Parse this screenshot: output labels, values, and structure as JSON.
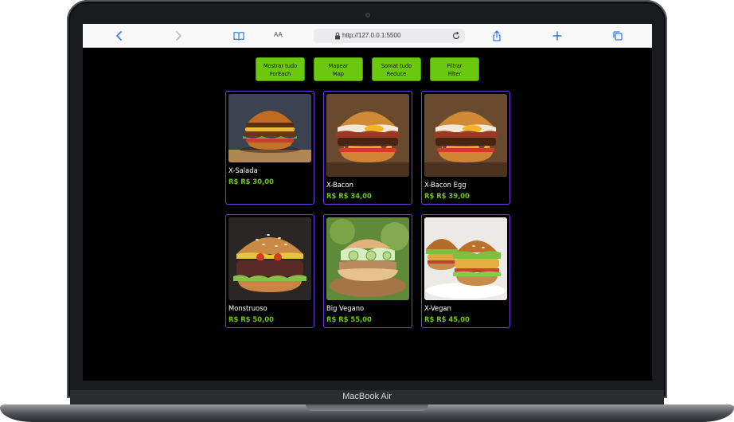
{
  "device": {
    "label": "MacBook Air"
  },
  "browser": {
    "reader_label": "AA",
    "url": "http://127.0.0.1:5500"
  },
  "buttons": [
    {
      "line1": "Mostrar tudo",
      "line2": "ForEach"
    },
    {
      "line1": "Mapear",
      "line2": "Map"
    },
    {
      "line1": "Somat tudo",
      "line2": "Reduce"
    },
    {
      "line1": "Filtrar",
      "line2": "Filter"
    }
  ],
  "products": [
    {
      "name": "X-Salada",
      "price": "R$ R$ 30,00"
    },
    {
      "name": "X-Bacon",
      "price": "R$ R$ 34,00"
    },
    {
      "name": "X-Bacon Egg",
      "price": "R$ R$ 39,00"
    },
    {
      "name": "Monstruoso",
      "price": "R$ R$ 50,00"
    },
    {
      "name": "Big Vegano",
      "price": "R$ R$ 55,00"
    },
    {
      "name": "X-Vegan",
      "price": "R$ R$ 45,00"
    }
  ],
  "colors": {
    "button_green": "#6cc80f",
    "card_border": "#6f3fdc",
    "price_green": "#6cc80f",
    "page_bg": "#000000"
  }
}
